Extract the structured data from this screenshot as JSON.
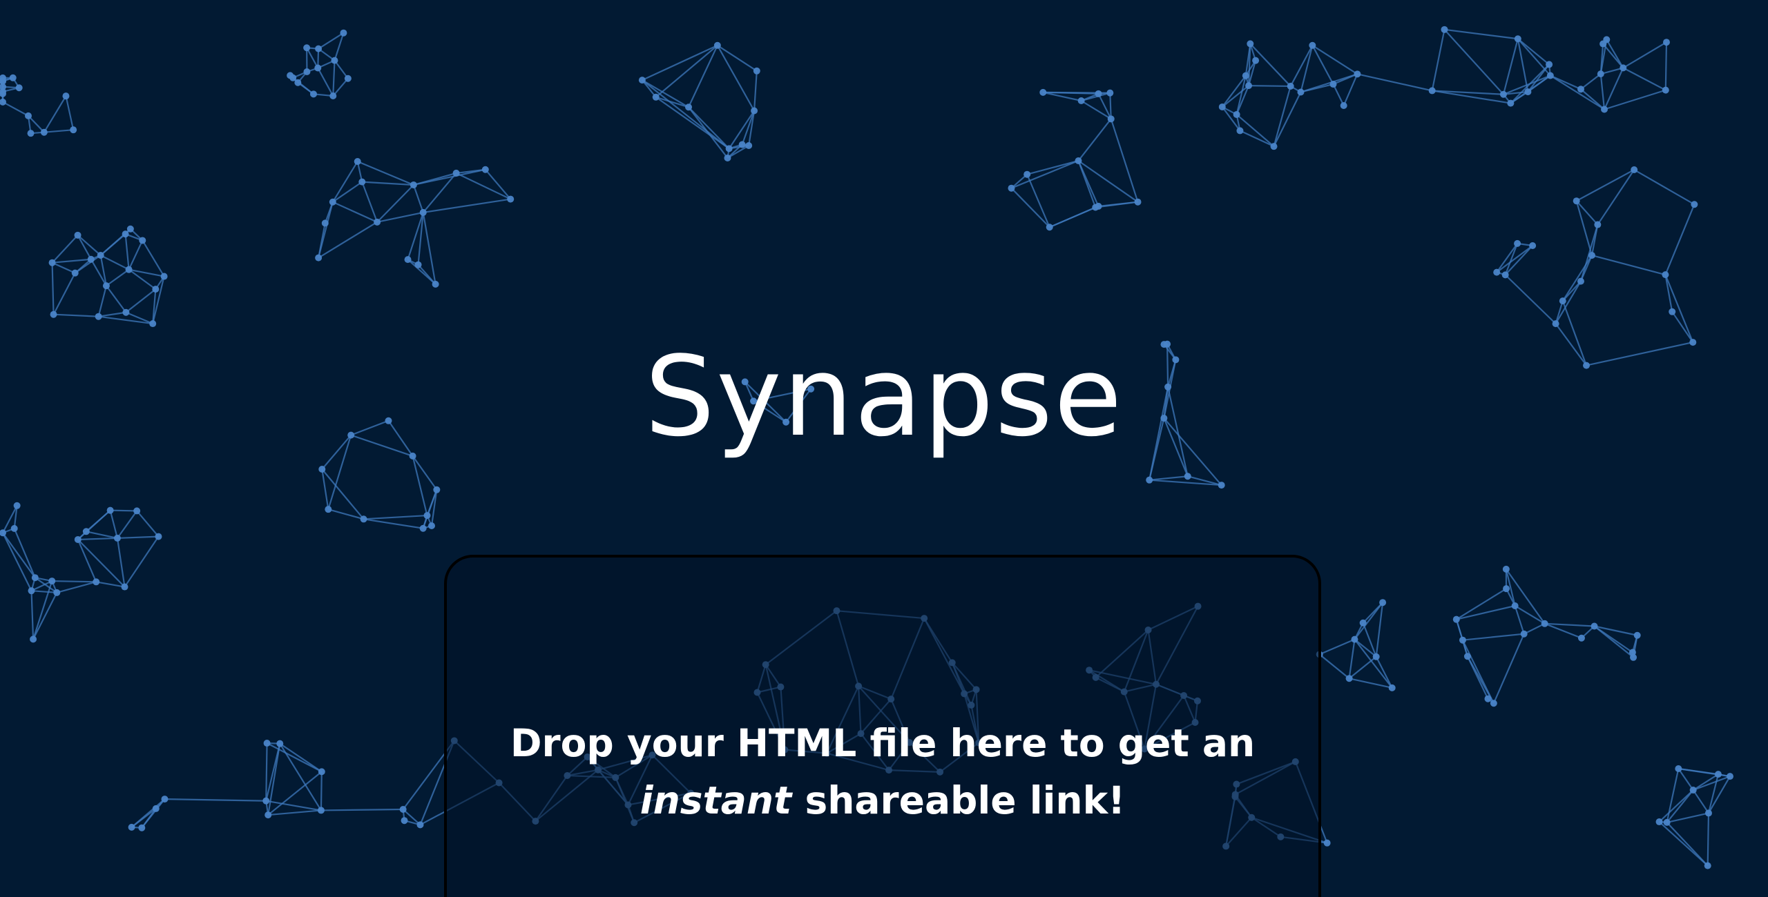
{
  "app": {
    "title": "Synapse"
  },
  "dropzone": {
    "line1": "Drop your HTML file here to get an",
    "emphasis": "instant",
    "line2_rest": " shareable link!"
  },
  "colors": {
    "background": "#021a33",
    "network_line": "#3f79bd",
    "network_node": "#4a84c8",
    "text": "#ffffff",
    "dropzone_border": "#000000"
  },
  "icons": {
    "background": "network-graph-pattern"
  }
}
